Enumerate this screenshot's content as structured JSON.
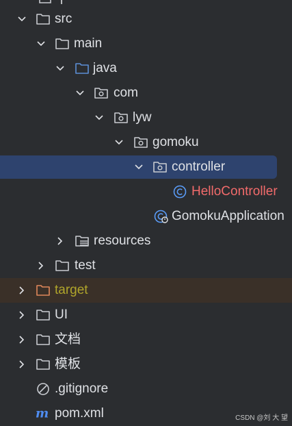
{
  "tree": {
    "items": [
      {
        "label": "src",
        "kind": "folder",
        "expanded": true
      },
      {
        "label": "main",
        "kind": "folder",
        "expanded": true
      },
      {
        "label": "java",
        "kind": "source-folder",
        "expanded": true
      },
      {
        "label": "com",
        "kind": "package",
        "expanded": true
      },
      {
        "label": "lyw",
        "kind": "package",
        "expanded": true
      },
      {
        "label": "gomoku",
        "kind": "package",
        "expanded": true
      },
      {
        "label": "controller",
        "kind": "package",
        "expanded": true,
        "selected": true
      },
      {
        "label": "HelloController",
        "kind": "class"
      },
      {
        "label": "GomokuApplication",
        "kind": "spring-class"
      },
      {
        "label": "resources",
        "kind": "resources-folder",
        "expanded": false
      },
      {
        "label": "test",
        "kind": "folder",
        "expanded": false
      },
      {
        "label": "target",
        "kind": "excluded-folder",
        "expanded": false
      },
      {
        "label": "UI",
        "kind": "folder",
        "expanded": false
      },
      {
        "label": "文档",
        "kind": "folder",
        "expanded": false
      },
      {
        "label": "模板",
        "kind": "folder",
        "expanded": false
      },
      {
        "label": ".gitignore",
        "kind": "gitignore"
      },
      {
        "label": "pom.xml",
        "kind": "maven"
      }
    ]
  },
  "watermark": "CSDN @刘 大 望",
  "colors": {
    "background": "#2b2d30",
    "selection": "#2e436e",
    "excluded_row": "#3a3028",
    "text": "#dfe1e5",
    "class_text_modified": "#f26b6b",
    "excluded_text": "#b0a52b",
    "folder_icon": "#c9ccd1",
    "source_folder_icon": "#5c8fd6",
    "class_icon": "#5a9cf8",
    "maven_icon": "#4f8cf0"
  }
}
